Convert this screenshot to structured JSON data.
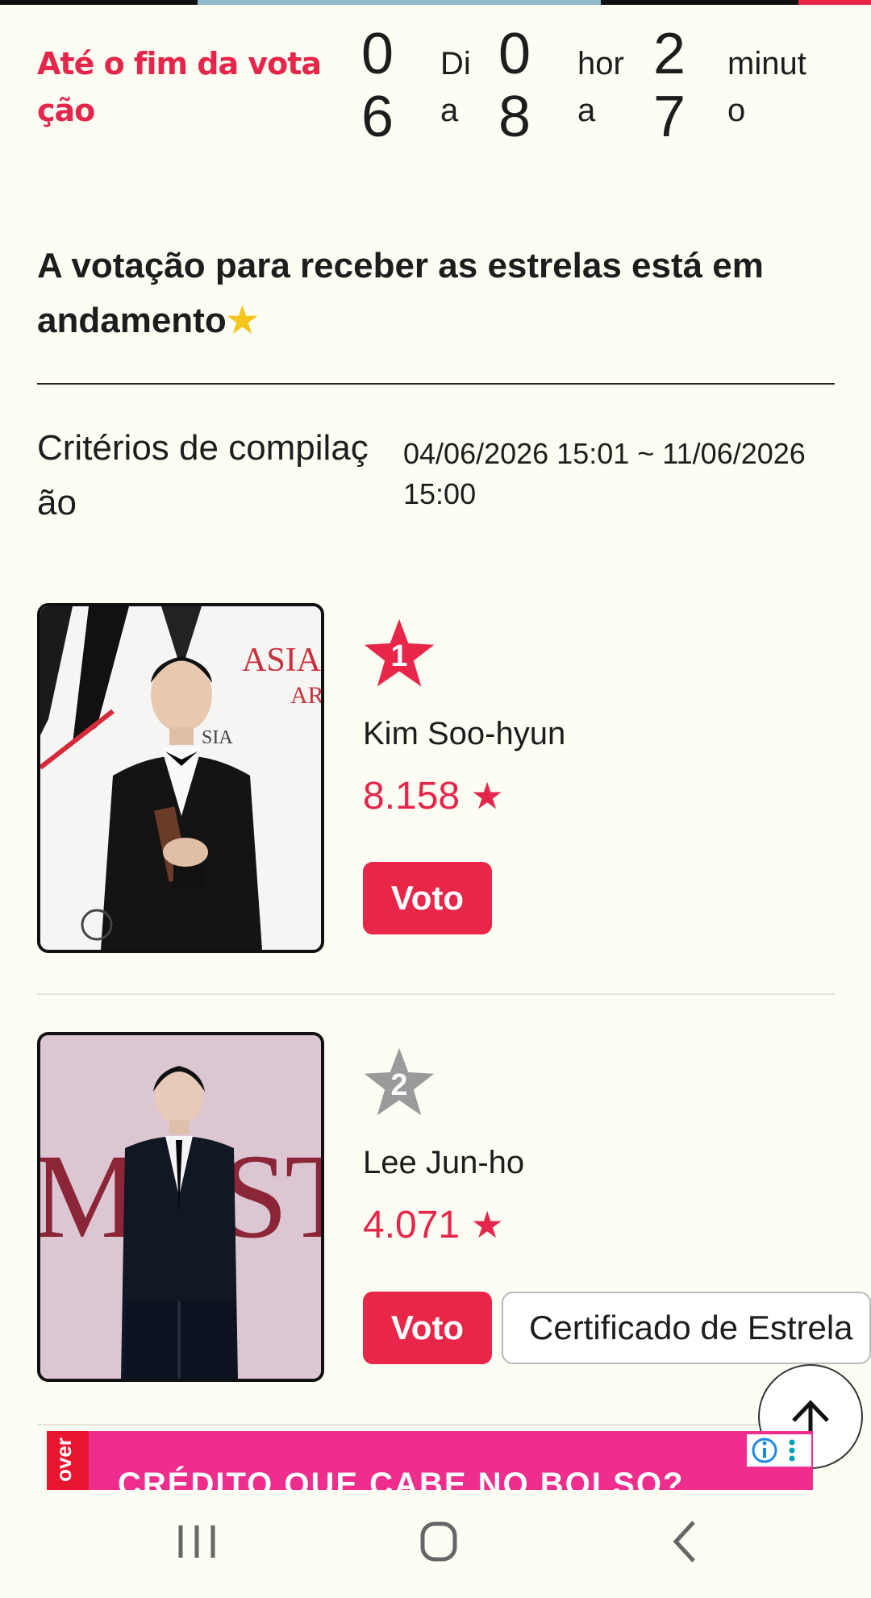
{
  "countdown": {
    "label": "Até o fim da votação",
    "days_value": "06",
    "days_unit": "Dia",
    "hours_value": "08",
    "hours_unit": "hora",
    "minutes_value": "27",
    "minutes_unit": "minuto"
  },
  "headline": "A votação para receber as estrelas está em andamento",
  "criteria": {
    "label": "Critérios de compilação",
    "value": "04/06/2026 15:01 ~ 11/06/2026 15:00"
  },
  "entries": [
    {
      "rank": "1",
      "name": "Kim Soo-hyun",
      "score": "8.158",
      "vote_label": "Voto"
    },
    {
      "rank": "2",
      "name": "Lee Jun-ho",
      "score": "4.071",
      "vote_label": "Voto",
      "certificate_label": "Certificado de Estrela"
    }
  ],
  "ad": {
    "side_label": "over",
    "text": "CRÉDITO QUE CABE NO BOLSO?"
  },
  "colors": {
    "accent": "#e8264a",
    "background": "#fdfdf3",
    "rank1": "#e8264a",
    "rank2": "#9a9a9a",
    "ad": "#ef2d8c"
  },
  "icons": {
    "scroll_top": "arrow-up-icon",
    "score_star": "star-icon",
    "headline_emoji": "star-emoji-icon",
    "nav": [
      "recents-icon",
      "home-icon",
      "back-icon"
    ]
  }
}
